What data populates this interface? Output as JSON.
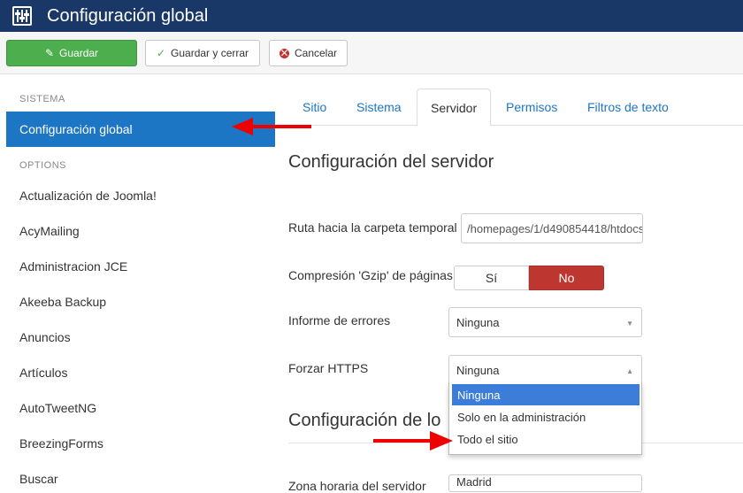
{
  "header": {
    "title": "Configuración global",
    "icon": "sliders-icon"
  },
  "toolbar": {
    "save": "Guardar",
    "save_close": "Guardar y cerrar",
    "cancel": "Cancelar",
    "colors": {
      "save_bg": "#4cae4c",
      "header_bg": "#1a3867"
    }
  },
  "sidebar": {
    "section1": "SISTEMA",
    "active_item": "Configuración global",
    "section2": "OPTIONS",
    "items": [
      "Actualización de Joomla!",
      "AcyMailing",
      "Administracion JCE",
      "Akeeba Backup",
      "Anuncios",
      "Artículos",
      "AutoTweetNG",
      "BreezingForms",
      "Buscar"
    ]
  },
  "tabs": [
    "Sitio",
    "Sistema",
    "Servidor",
    "Permisos",
    "Filtros de texto"
  ],
  "active_tab": "Servidor",
  "main": {
    "heading1": "Configuración del servidor",
    "temp_path_label": "Ruta hacia la carpeta temporal",
    "temp_path_value": "/homepages/1/d490854418/htdocs",
    "gzip_label": "Compresión 'Gzip' de páginas",
    "gzip_yes": "Sí",
    "gzip_no": "No",
    "errors_label": "Informe de errores",
    "errors_value": "Ninguna",
    "https_label": "Forzar HTTPS",
    "https_value": "Ninguna",
    "https_options": [
      "Ninguna",
      "Solo en la administración",
      "Todo el sitio"
    ],
    "heading2": "Configuración de lo",
    "timezone_label": "Zona horaria del servidor",
    "timezone_value": "Madrid"
  }
}
